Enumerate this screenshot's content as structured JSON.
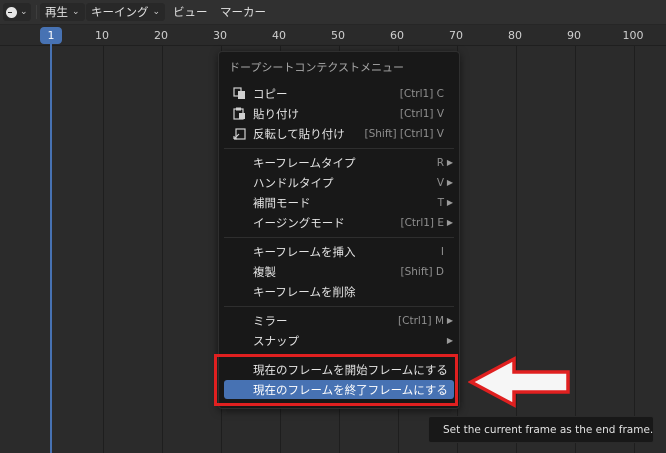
{
  "header": {
    "editor_icon": "dopesheet-clock-icon",
    "menus": [
      {
        "label": "再生",
        "dropdown": true
      },
      {
        "label": "キーイング",
        "dropdown": true
      },
      {
        "label": "ビュー",
        "dropdown": false
      },
      {
        "label": "マーカー",
        "dropdown": false
      }
    ]
  },
  "ruler": {
    "current_frame": "1",
    "ticks": [
      "10",
      "20",
      "30",
      "40",
      "50",
      "60",
      "70",
      "80",
      "90",
      "100"
    ]
  },
  "context_menu": {
    "title": "ドープシートコンテクストメニュー",
    "groups": [
      [
        {
          "label": "コピー",
          "shortcut": "[Ctrl1] C",
          "icon": "copy-icon"
        },
        {
          "label": "貼り付け",
          "shortcut": "[Ctrl1] V",
          "icon": "paste-icon"
        },
        {
          "label": "反転して貼り付け",
          "shortcut": "[Shift] [Ctrl1] V",
          "icon": "paste-flipped-icon"
        }
      ],
      [
        {
          "label": "キーフレームタイプ",
          "shortcut": "R",
          "submenu": true
        },
        {
          "label": "ハンドルタイプ",
          "shortcut": "V",
          "submenu": true
        },
        {
          "label": "補間モード",
          "shortcut": "T",
          "submenu": true
        },
        {
          "label": "イージングモード",
          "shortcut": "[Ctrl1] E",
          "submenu": true
        }
      ],
      [
        {
          "label": "キーフレームを挿入",
          "shortcut": "I"
        },
        {
          "label": "複製",
          "shortcut": "[Shift] D"
        },
        {
          "label": "キーフレームを削除",
          "shortcut": ""
        }
      ],
      [
        {
          "label": "ミラー",
          "shortcut": "[Ctrl1] M",
          "submenu": true
        },
        {
          "label": "スナップ",
          "shortcut": "",
          "submenu": true
        }
      ],
      [
        {
          "label": "現在のフレームを開始フレームにする",
          "shortcut": ""
        },
        {
          "label": "現在のフレームを終了フレームにする",
          "shortcut": "",
          "active": true
        }
      ]
    ]
  },
  "tooltip": {
    "text": "Set the current frame as the end frame."
  },
  "annotation": {
    "color": "#e02020",
    "shape": "red-arrow-icon"
  },
  "colors": {
    "accent": "#4772b3",
    "menu_bg": "#181818",
    "timeline_bg": "#2b2b2b"
  }
}
